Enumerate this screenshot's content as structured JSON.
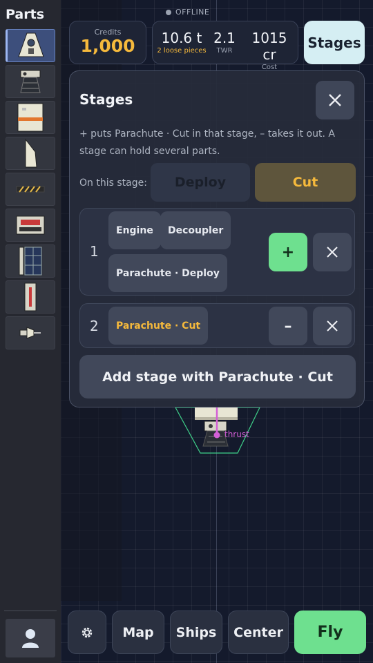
{
  "sidebar": {
    "title": "Parts",
    "items": [
      {
        "icon": "command-pod-icon",
        "selected": true
      },
      {
        "icon": "engine-icon",
        "selected": false
      },
      {
        "icon": "fuel-tank-icon",
        "selected": false
      },
      {
        "icon": "fin-icon",
        "selected": false
      },
      {
        "icon": "decoupler-icon",
        "selected": false
      },
      {
        "icon": "battery-icon",
        "selected": false
      },
      {
        "icon": "solar-panel-icon",
        "selected": false
      },
      {
        "icon": "thermometer-icon",
        "selected": false
      },
      {
        "icon": "antenna-icon",
        "selected": false
      }
    ],
    "profile_icon": "user-icon"
  },
  "status": {
    "text": "OFFLINE"
  },
  "credits": {
    "label": "Credits",
    "value": "1,000"
  },
  "stats": {
    "mass": {
      "value": "10.6 t",
      "label": "2 loose pieces"
    },
    "twr": {
      "value": "2.1",
      "label": "TWR"
    },
    "cost": {
      "value": "1015 cr",
      "label": "Cost"
    }
  },
  "stages_button": {
    "label": "Stages"
  },
  "canvas": {
    "thrust_label": "thrust"
  },
  "stages_panel": {
    "title": "Stages",
    "help": "+ puts Parachute · Cut in that stage, – takes it out. A stage can hold several parts.",
    "on_stage_label": "On this stage:",
    "modes": {
      "deploy": "Deploy",
      "cut": "Cut",
      "selected": "Cut"
    },
    "stages": [
      {
        "number": "1",
        "parts": [
          "Engine",
          "Decoupler",
          "Parachute · Deploy"
        ],
        "action": "+",
        "remove": "✕"
      },
      {
        "number": "2",
        "parts": [
          "Parachute · Cut"
        ],
        "action": "–",
        "remove": "✕"
      }
    ],
    "add_stage_label": "Add stage with Parachute · Cut"
  },
  "bottom_bar": {
    "settings_icon": "gear-icon",
    "map": "Map",
    "ships": "Ships",
    "center": "Center",
    "fly": "Fly"
  },
  "colors": {
    "accent_green": "#6ee08f",
    "credits_gold": "#f5b93c",
    "thrust_magenta": "#d35fd6"
  }
}
